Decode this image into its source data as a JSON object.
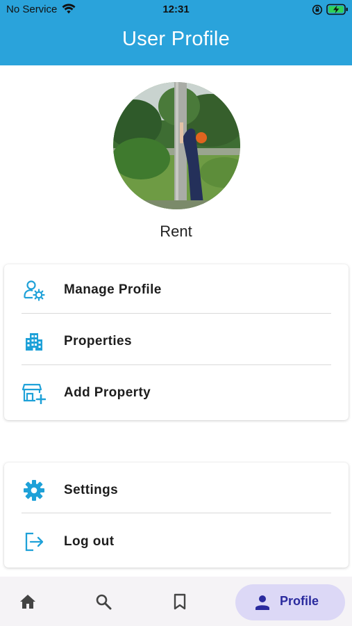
{
  "status_bar": {
    "carrier": "No Service",
    "time": "12:31"
  },
  "app_bar": {
    "title": "User Profile"
  },
  "profile": {
    "name": "Rent"
  },
  "menu_main": [
    {
      "label": "Manage Profile",
      "icon": "user-gear-icon"
    },
    {
      "label": "Properties",
      "icon": "building-icon"
    },
    {
      "label": "Add Property",
      "icon": "store-add-icon"
    }
  ],
  "menu_secondary": [
    {
      "label": "Settings",
      "icon": "gear-icon"
    },
    {
      "label": "Log out",
      "icon": "logout-icon"
    }
  ],
  "bottom_nav": {
    "items": [
      {
        "icon": "home-icon"
      },
      {
        "icon": "search-icon"
      },
      {
        "icon": "bookmark-icon"
      }
    ],
    "active_label": "Profile"
  },
  "colors": {
    "app_bar": "#2aa3db",
    "icon_accent": "#1ea1d8",
    "nav_active_bg": "#dcd8f6",
    "nav_active_fg": "#2a2a9e"
  }
}
